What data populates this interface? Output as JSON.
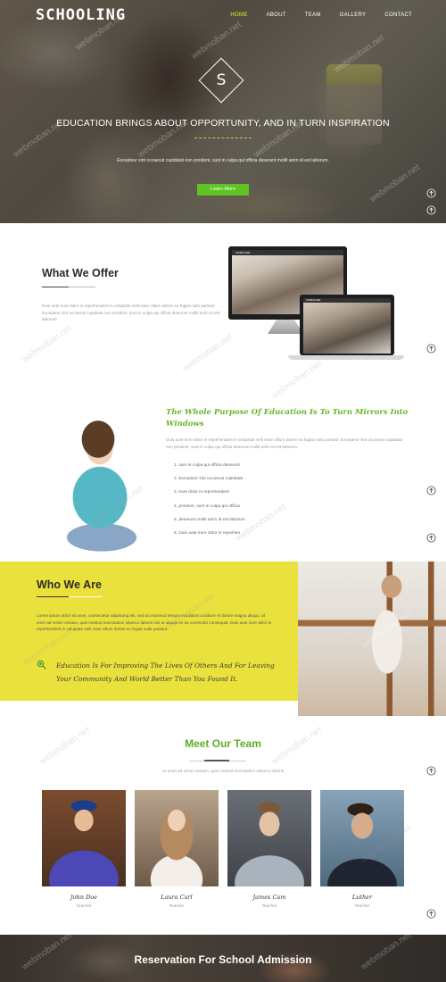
{
  "header": {
    "logo": "SCHOOLING",
    "nav": [
      {
        "label": "HOME",
        "active": true
      },
      {
        "label": "ABOUT",
        "active": false
      },
      {
        "label": "TEAM",
        "active": false
      },
      {
        "label": "GALLERY",
        "active": false
      },
      {
        "label": "CONTACT",
        "active": false
      }
    ]
  },
  "hero": {
    "emblem_letter": "S",
    "title": "EDUCATION BRINGS ABOUT OPPORTUNITY, AND IN TURN INSPIRATION",
    "text": "Excepteur sint occaecat cupidatat non proident, sunt in culpa qui officia deserunt mollit anim id est laborum.",
    "button_label": "Learn More"
  },
  "offer": {
    "title": "What We Offer",
    "text": "Duis aute irure dolor in reprehenderit in voluptate velit esse cillum dolore eu fugiat nulla pariatur. Excepteur sint occaecat cupidatat non proident, sunt in culpa qui officia deserunt mollit anim id est laborum.",
    "device_brand": "SCHOOLING"
  },
  "purpose": {
    "title": "The Whole Purpose Of Education Is To Turn Mirrors Into Windows",
    "text": "Duis aute irure dolor in reprehenderit in voluptate velit esse cillum dolore eu fugiat nulla pariatur. Excepteur sint occaecat cupidatat non proident, sunt in culpa qui officia deserunt mollit anim id est laborum.",
    "list": [
      "1. sunt in culpa qui officia deserunt",
      "2. Excepteur sint occaecat cupidatat",
      "3. irure dolor in reprehenderit",
      "4. proident, sunt in culpa qui officia",
      "5. deserunt mollit anim id est laborum",
      "6. Duis aute irure dolor in reprehen"
    ]
  },
  "who": {
    "title": "Who We Are",
    "text": "Lorem ipsum dolor sit amet, consectetur adipiscing elit, sed do eiusmod tempor incididunt ut labore et dolore magna aliqua. Ut enim ad minim veniam, quis nostrud exercitation ullamco laboris nisi ut aliquip ex ea commodo consequat. Duis aute irure dolor in reprehenderit in voluptate velit esse cillum dolore eu fugiat nulla pariatur.",
    "quote": "Education Is For Improving The Lives Of Others And For Leaving Your Community And World Better Than You Found It."
  },
  "team": {
    "title": "Meet Our Team",
    "subtitle": "Ut enim ad minim veniam, quis nostrud exercitation ullamco laboris",
    "members": [
      {
        "name": "John Doe",
        "role": "Teacher"
      },
      {
        "name": "Laura Carl",
        "role": "Teacher"
      },
      {
        "name": "James Cam",
        "role": "Teacher"
      },
      {
        "name": "Luther",
        "role": "Teacher"
      }
    ]
  },
  "reservation": {
    "title": "Reservation For School Admission"
  },
  "watermark": "webmoban.net",
  "colors": {
    "accent_green": "#5fc321",
    "band_yellow": "#ebe13c",
    "nav_active": "#f3ea2c"
  }
}
